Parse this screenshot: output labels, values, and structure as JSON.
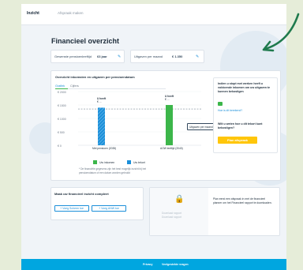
{
  "header": {
    "brand": "Inzicht",
    "nav_link": "Afspraak maken"
  },
  "page": {
    "title": "Financieel overzicht"
  },
  "stats": {
    "retirement_label": "Gewenste pensioenleeftijd",
    "retirement_value": "63 jaar",
    "spending_label": "Uitgaven per maand",
    "spending_value": "€ 1.350"
  },
  "overview": {
    "title": "Overzicht inkomsten en uitgaven per pensioendatum",
    "tabs": [
      "Grafiek",
      "Cijfers"
    ],
    "legend_income": "Uw inkomen",
    "legend_shortfall": "Uw tekort",
    "footnote_line1": "* De financiële gegevens zijn het best mogelijk inzicht bij het",
    "footnote_line2": "pensioendatum of een datum worden gebruikt",
    "tooltip": "Uitgaven per maand",
    "bar1_top": "U heeft",
    "bar1_top2": "€ ...",
    "bar2_top": "U heeft",
    "bar2_top2": "€ ..."
  },
  "chart_data": {
    "type": "bar",
    "categories": [
      "Met pensioen (2035)",
      "AOW leeftijd (2040)"
    ],
    "series": [
      {
        "name": "Uw inkomen",
        "values": [
          0,
          1500
        ]
      },
      {
        "name": "Uw tekort",
        "values": [
          1400,
          0
        ]
      }
    ],
    "y_ticks": [
      "€ 2000",
      "€ 1500",
      "€ 1000",
      "€ 500",
      "€ 0"
    ],
    "ylim": [
      0,
      2000
    ],
    "threshold": 1350
  },
  "sidebar": {
    "q1": "Indien u stopt met werken heeft u voldoende inkomen om uw uitgaven te kunnen bekostigen",
    "q1_link": "Hoe is dit berekend?",
    "q2": "Wilt u weten hoe u dit tekort kunt bekostigen?",
    "cta": "Plan afspraak"
  },
  "complete": {
    "title": "Maak uw financieel inzicht compleet",
    "btn1": "+ Voeg Scherm toe",
    "btn2": "+ Voeg ANW toe"
  },
  "locked": {
    "line1": "Download rapport",
    "line2": "Download rapport"
  },
  "plan_note": {
    "text": "Plan eerst een afspraak in met de financieel planner om het Financieel rapport te downloaden."
  },
  "footer": {
    "privacy": "Privacy",
    "faq": "Veelgestelde vragen"
  },
  "colors": {
    "income": "#3cb64a",
    "shortfall": "#1b8fd9",
    "accent": "#00a6e0",
    "cta": "#ffc60a",
    "arrow": "#1f7a4d"
  }
}
